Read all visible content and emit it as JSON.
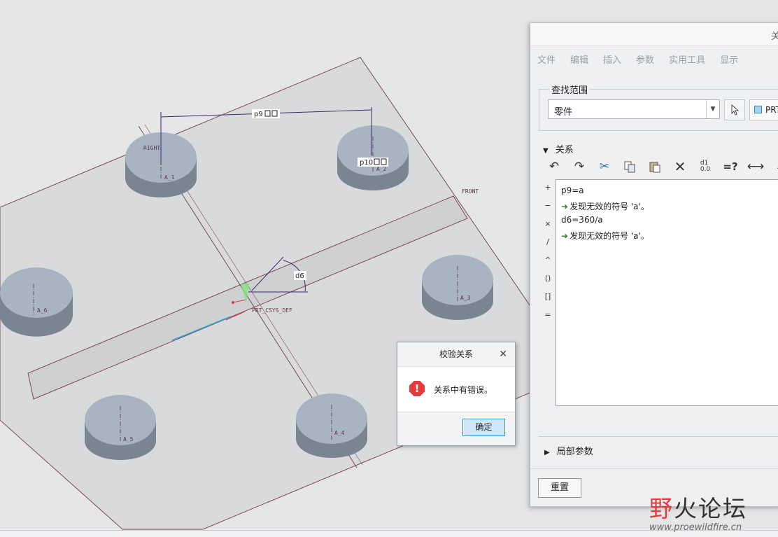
{
  "model": {
    "dim_p9": "p9",
    "dim_p10": "p10",
    "dim_d6": "d6",
    "plane_right": "RIGHT",
    "plane_front": "FRONT",
    "csys": "PRT_CSYS_DEF",
    "axes": [
      "A_1",
      "A_2",
      "A_3",
      "A_4",
      "A_5",
      "A_6"
    ]
  },
  "relations_dialog": {
    "title": "关",
    "menu": [
      "文件",
      "编辑",
      "插入",
      "参数",
      "实用工具",
      "显示"
    ],
    "scope_label": "查找范围",
    "scope_value": "零件",
    "prt_button": "PRT",
    "relations_section": "关系",
    "toolbar_icons": [
      "undo-icon",
      "redo-icon",
      "cut-icon",
      "copy-icon",
      "paste-icon",
      "delete-icon",
      "evaluate-icon",
      "verify-icon",
      "units-icon",
      "sort-icon"
    ],
    "side_ops": [
      "+",
      "−",
      "×",
      "/",
      "^",
      "()",
      "[]",
      "="
    ],
    "lines": [
      {
        "text": "p9=a",
        "error": false
      },
      {
        "text": "发现无效的符号 'a'。",
        "error": true
      },
      {
        "text": "d6=360/a",
        "error": false
      },
      {
        "text": "发现无效的符号 'a'。",
        "error": true
      }
    ],
    "local_params": "局部参数",
    "reset": "重置"
  },
  "message_box": {
    "title": "校验关系",
    "text": "关系中有错误。",
    "ok": "确定"
  },
  "watermark": {
    "part1": "野",
    "part2": "火论坛",
    "url": "www.proewildfire.cn"
  }
}
